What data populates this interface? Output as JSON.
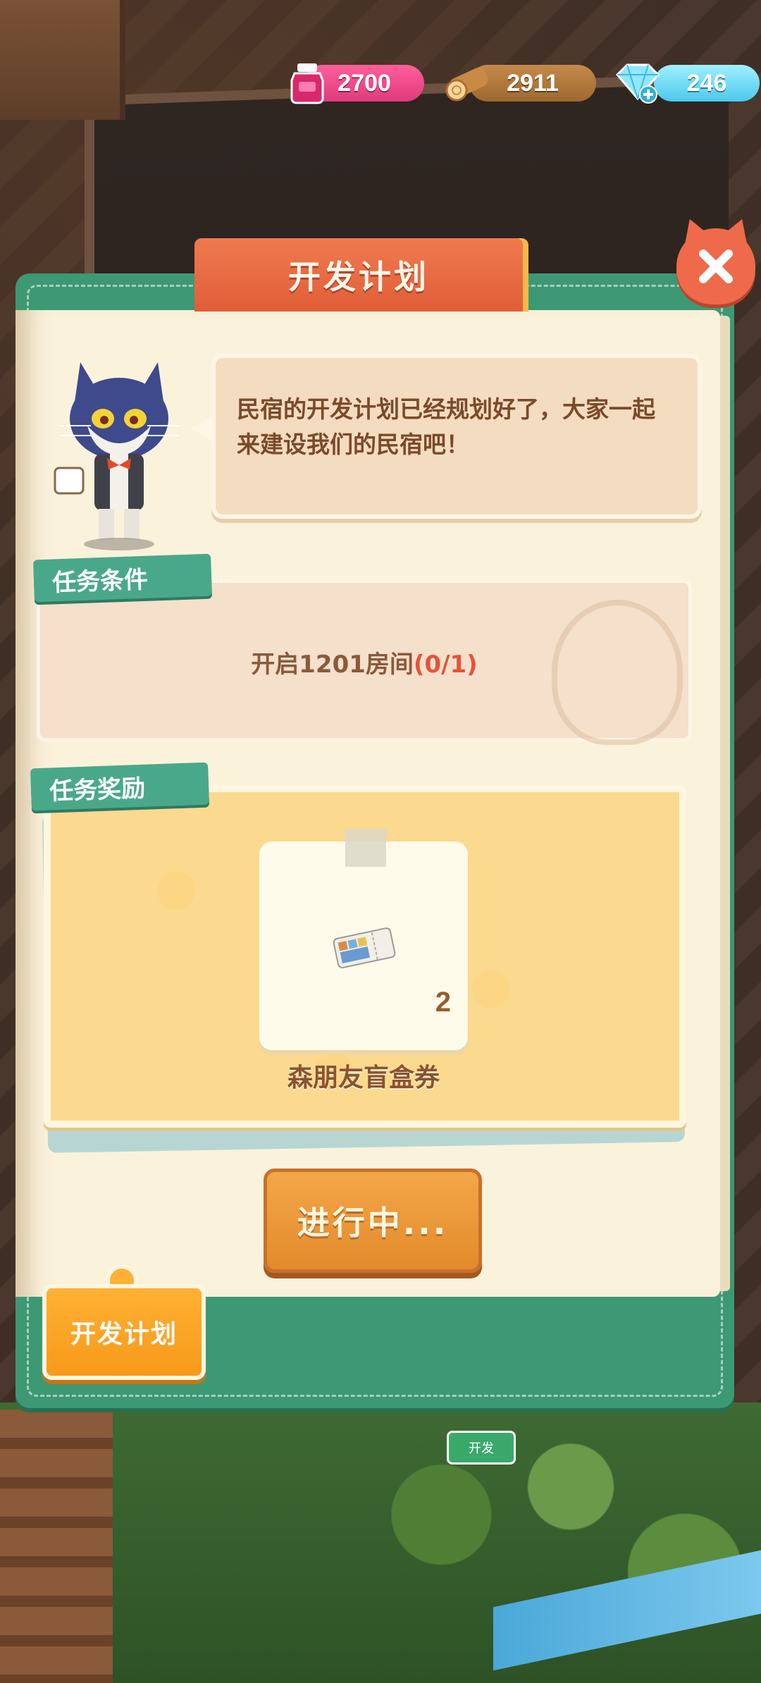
{
  "currencies": {
    "ink": {
      "value": "2700",
      "icon": "ink-bottle-icon"
    },
    "wood": {
      "value": "2911",
      "icon": "wood-log-icon"
    },
    "gem": {
      "value": "246",
      "icon": "diamond-plus-icon"
    }
  },
  "dialog": {
    "title": "开发计划",
    "close_icon": "close-icon",
    "speech": "民宿的开发计划已经规划好了，大家一起来建设我们的民宿吧！",
    "conditions_label": "任务条件",
    "condition_prefix": "开启1201房间",
    "condition_progress": "(0/1)",
    "rewards_label": "任务奖励",
    "reward": {
      "name": "森朋友盲盒券",
      "count": "2",
      "icon": "ticket-icon"
    },
    "action_button": "进行中...",
    "side_tab": "开发计划"
  },
  "scene": {
    "garden_sign": "开发"
  },
  "colors": {
    "panel_green": "#3d9874",
    "title_orange": "#e05e37",
    "button_orange": "#e38a2c",
    "page_cream": "#fbf2dc",
    "progress_red": "#e2553a"
  }
}
